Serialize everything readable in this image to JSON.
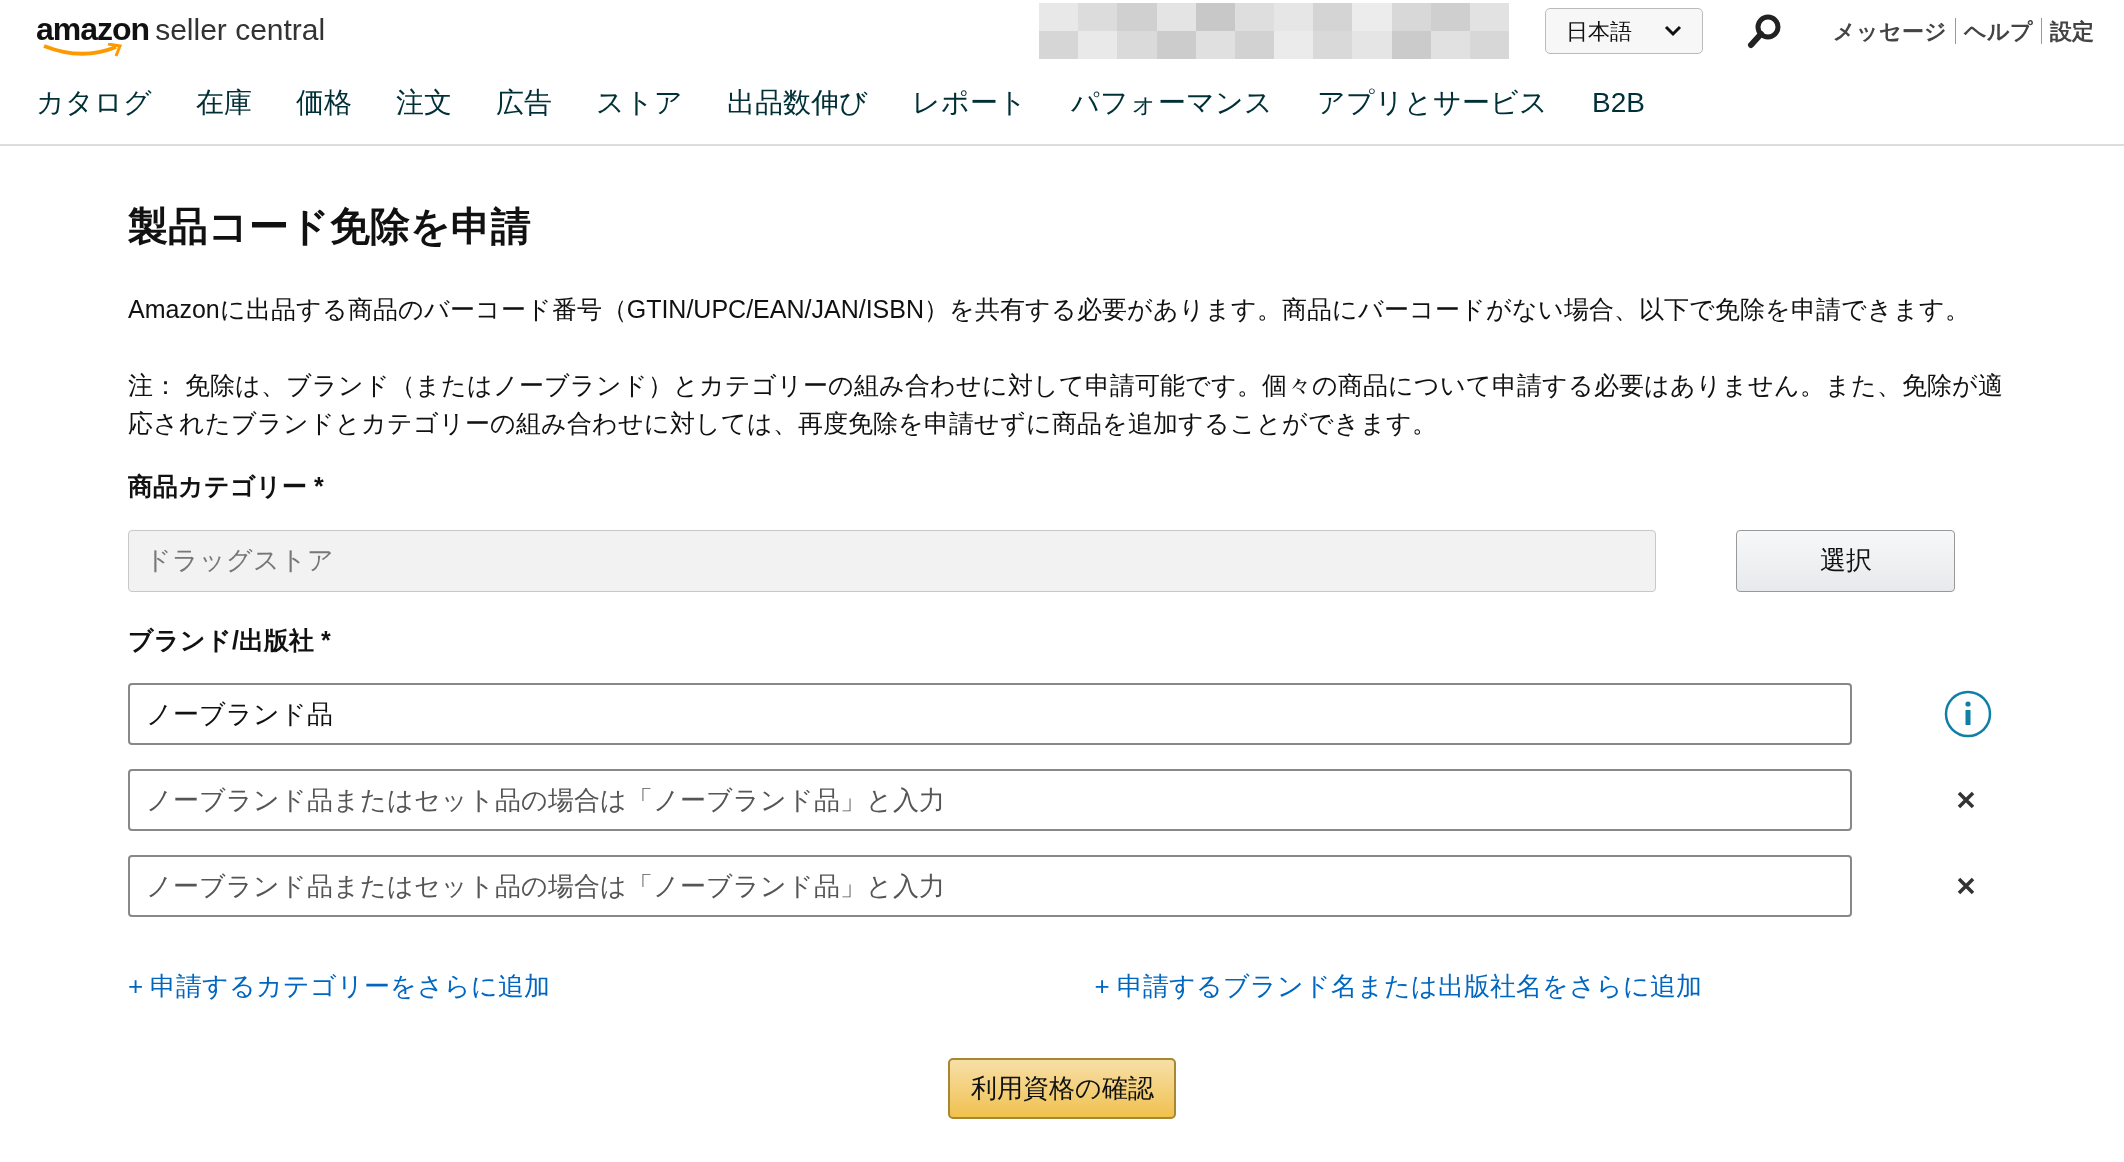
{
  "header": {
    "logo": {
      "brand": "amazon",
      "product": "seller central"
    },
    "language": "日本語",
    "links": [
      "メッセージ",
      "ヘルプ",
      "設定"
    ]
  },
  "nav": [
    "カタログ",
    "在庫",
    "価格",
    "注文",
    "広告",
    "ストア",
    "出品数伸び",
    "レポート",
    "パフォーマンス",
    "アプリとサービス",
    "B2B"
  ],
  "page": {
    "title": "製品コード免除を申請",
    "intro": "Amazonに出品する商品のバーコード番号（GTIN/UPC/EAN/JAN/ISBN）を共有する必要があります。商品にバーコードがない場合、以下で免除を申請できます。",
    "note": "注： 免除は、ブランド（またはノーブランド）とカテゴリーの組み合わせに対して申請可能です。個々の商品について申請する必要はありません。また、免除が適応されたブランドとカテゴリーの組み合わせに対しては、再度免除を申請せずに商品を追加することができます。",
    "category": {
      "label": "商品カテゴリー *",
      "value": "ドラッグストア",
      "disabled": true,
      "button": "選択"
    },
    "brand": {
      "label": "ブランド/出版社 *",
      "fields": [
        {
          "value": "ノーブランド品",
          "kind": "info"
        },
        {
          "placeholder": "ノーブランド品またはセット品の場合は「ノーブランド品」と入力",
          "kind": "remove"
        },
        {
          "placeholder": "ノーブランド品またはセット品の場合は「ノーブランド品」と入力",
          "kind": "remove"
        }
      ]
    },
    "add_links": [
      "+ 申請するカテゴリーをさらに追加",
      "+ 申請するブランド名または出版社名をさらに追加"
    ],
    "submit": "利用資格の確認"
  }
}
